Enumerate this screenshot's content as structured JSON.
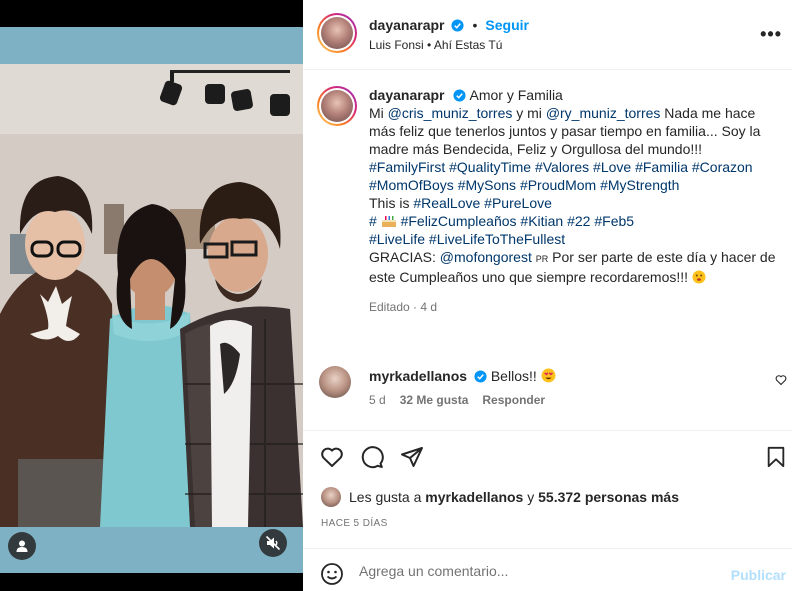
{
  "post": {
    "username": "dayanarapr",
    "follow_label": "Seguir",
    "separator": "•",
    "audio": "Luis Fonsi • Ahí Estas Tú",
    "more_label": "•••"
  },
  "caption": {
    "username": "dayanarapr",
    "line1_text": "Amor y Familia",
    "mention1": "@cris_muniz_torres",
    "and_text": "y mi",
    "mention2": "@ry_muniz_torres",
    "body_rest": "Nada me hace más feliz que tenerlos juntos y pasar tiempo en familia... Soy la madre más Bendecida, Feliz y Orgullosa del mundo!!!",
    "hashtags1": "#FamilyFirst #QualityTime #Valores #Love #Familia #Corazon",
    "hashtags2": "#MomOfBoys #MySons #ProudMom #MyStrength",
    "this_is": "This is",
    "hashtags3": "#RealLove #PureLove",
    "hashtags4_pre": "#",
    "hashtags4_post": "#FelizCumpleaños #Kitian #22 #Feb5",
    "hashtags5": "#LiveLife #LiveLifeToTheFullest",
    "gracias": "GRACIAS:",
    "mention3": "@mofongorest",
    "pr_flag": "PR",
    "thanks_rest": "Por ser parte de este día y hacer de este Cumpleaños uno que siempre recordaremos!!!",
    "meta": "Editado · 4 d"
  },
  "comment": {
    "username": "myrkadellanos",
    "text": "Bellos!!",
    "age": "5 d",
    "likes": "32 Me gusta",
    "reply": "Responder"
  },
  "likes": {
    "prefix": "Les gusta a",
    "user": "myrkadellanos",
    "and": "y",
    "count": "55.372 personas más"
  },
  "date": "HACE 5 DÍAS",
  "composer": {
    "placeholder": "Agrega un comentario...",
    "post_label": "Publicar"
  },
  "colors": {
    "accent": "#0095f6",
    "link": "#00376b",
    "frame": "#7fb1c4"
  }
}
